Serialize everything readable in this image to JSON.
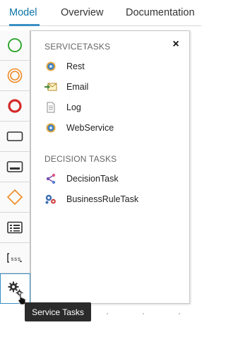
{
  "tabs": [
    {
      "label": "Model",
      "active": true
    },
    {
      "label": "Overview",
      "active": false
    },
    {
      "label": "Documentation",
      "active": false
    }
  ],
  "palette": {
    "items": [
      {
        "name": "start-event",
        "icon": "circle-green-icon"
      },
      {
        "name": "intermediate-event",
        "icon": "double-circle-orange-icon"
      },
      {
        "name": "end-event",
        "icon": "circle-red-thick-icon"
      },
      {
        "name": "task",
        "icon": "rectangle-icon"
      },
      {
        "name": "subprocess",
        "icon": "rounded-rect-icon"
      },
      {
        "name": "gateway",
        "icon": "diamond-orange-icon"
      },
      {
        "name": "form",
        "icon": "form-icon"
      },
      {
        "name": "script",
        "icon": "script-icon"
      },
      {
        "name": "service-tasks",
        "icon": "gears-icon",
        "selected": true
      }
    ]
  },
  "popup": {
    "close_label": "×",
    "service_section_title": "SERVICETASKS",
    "service_items": [
      {
        "label": "Rest",
        "icon": "gear-blue-icon"
      },
      {
        "label": "Email",
        "icon": "email-icon"
      },
      {
        "label": "Log",
        "icon": "document-icon"
      },
      {
        "label": "WebService",
        "icon": "gear-blue-icon"
      }
    ],
    "decision_section_title": "DECISION TASKS",
    "decision_items": [
      {
        "label": "DecisionTask",
        "icon": "decision-tree-icon"
      },
      {
        "label": "BusinessRuleTask",
        "icon": "business-rule-icon"
      }
    ]
  },
  "tooltip": {
    "text": "Service Tasks"
  },
  "colors": {
    "accent": "#3a8fc4",
    "green": "#22a022",
    "orange": "#f08a24",
    "red": "#d42a2a"
  }
}
